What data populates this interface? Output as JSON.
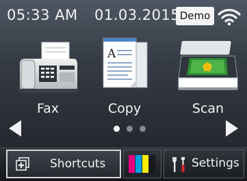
{
  "status_bar": {
    "time": "05:33 AM",
    "date": "01.03.2015",
    "demo_label": "Demo",
    "wifi_icon": "wifi-icon"
  },
  "apps": [
    {
      "label": "Fax",
      "icon": "fax-machine-icon"
    },
    {
      "label": "Copy",
      "icon": "copy-documents-icon"
    },
    {
      "label": "Scan",
      "icon": "scanner-icon"
    }
  ],
  "navigation": {
    "prev_icon": "arrow-left-icon",
    "next_icon": "arrow-right-icon",
    "page_count": 3,
    "current_page": 1
  },
  "bottom_bar": {
    "shortcuts_label": "Shortcuts",
    "shortcuts_icon": "add-shortcut-icon",
    "ink_icon": "ink-cartridges-icon",
    "ink_colors": [
      "#e6007e",
      "#009fe3",
      "#ffed00",
      "#1a1a1a"
    ],
    "settings_label": "Settings",
    "settings_icon": "tools-icon"
  },
  "colors": {
    "background_top": "#4e5763",
    "background_bottom": "#1d2127",
    "text": "#f4f4f4"
  }
}
